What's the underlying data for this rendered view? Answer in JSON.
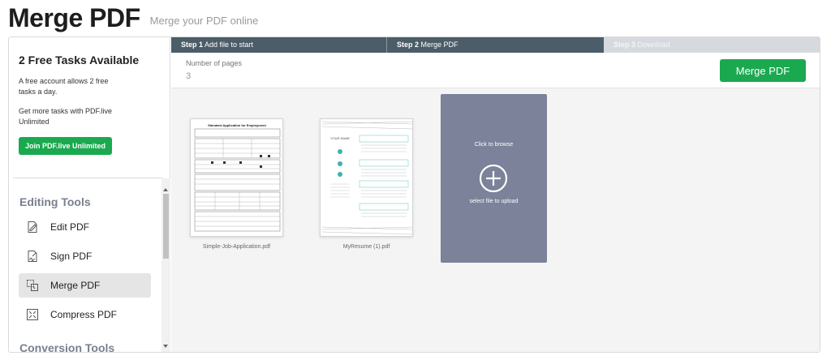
{
  "header": {
    "title": "Merge PDF",
    "subtitle": "Merge your PDF online"
  },
  "sidebar": {
    "promo": {
      "title": "2 Free Tasks Available",
      "text1": "A free account allows 2 free tasks a day.",
      "text2": "Get more tasks with PDF.live Unlimited",
      "button": "Join PDF.live Unlimited"
    },
    "sections": [
      {
        "title": "Editing Tools",
        "items": [
          {
            "label": "Edit PDF",
            "icon": "edit-icon",
            "active": false
          },
          {
            "label": "Sign PDF",
            "icon": "sign-icon",
            "active": false
          },
          {
            "label": "Merge PDF",
            "icon": "merge-icon",
            "active": true
          },
          {
            "label": "Compress PDF",
            "icon": "compress-icon",
            "active": false
          }
        ]
      },
      {
        "title": "Conversion Tools"
      }
    ]
  },
  "steps": [
    {
      "num": "Step 1",
      "label": "Add file to start"
    },
    {
      "num": "Step 2",
      "label": "Merge PDF"
    },
    {
      "num": "Step 3",
      "label": "Download"
    }
  ],
  "info": {
    "pages_label": "Number of pages",
    "pages_value": "3",
    "merge_button": "Merge PDF"
  },
  "files": [
    {
      "name": "Simple-Job-Application.pdf",
      "doc_title": "Standard Application for Employment"
    },
    {
      "name": "MyResume (1).pdf",
      "doc_title": "YOUR NAME"
    }
  ],
  "upload": {
    "line1": "Click to browse",
    "line2": "select file to upload"
  },
  "colors": {
    "accent_green": "#1aa94f",
    "step_dark": "#4b5d68",
    "upload_tile": "#7b8299"
  }
}
